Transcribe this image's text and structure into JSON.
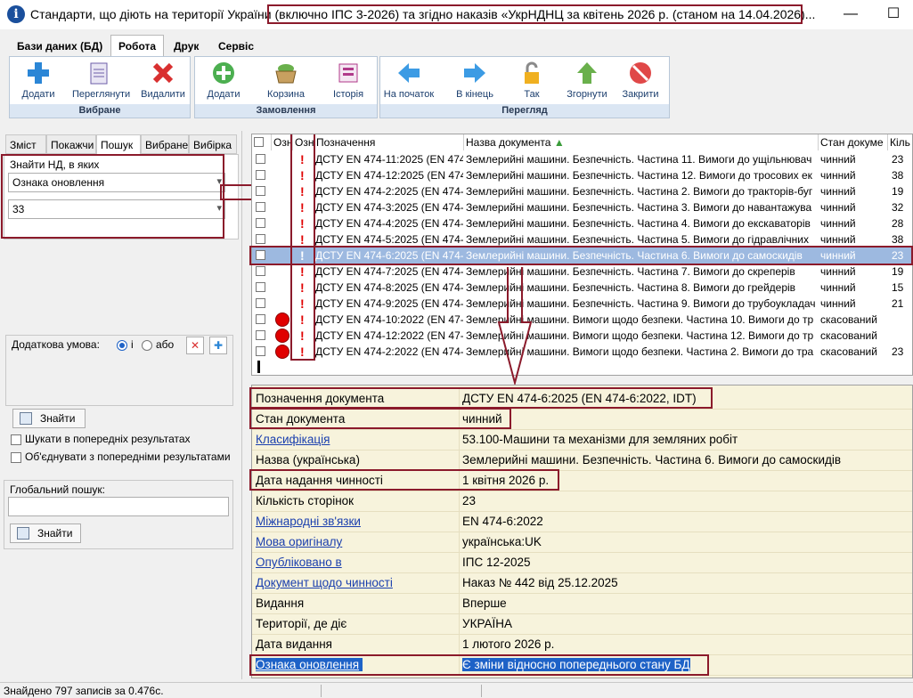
{
  "window": {
    "title": "Стандарти, що діють на території України (включно ІПС 3-2026) та згідно наказів «УкрНДНЦ за  квітень 2026 р. (станом на  14.04.2026)...",
    "minimize": "—",
    "maximize": "☐"
  },
  "menu": {
    "tabs": [
      "Бази даних (БД)",
      "Робота",
      "Друк",
      "Сервіс"
    ]
  },
  "ribbon": {
    "groups": [
      {
        "label": "Вибране",
        "buttons": [
          "Додати",
          "Переглянути",
          "Видалити"
        ]
      },
      {
        "label": "Замовлення",
        "buttons": [
          "Додати",
          "Корзина",
          "Історія"
        ]
      },
      {
        "label": "Перегляд",
        "buttons": [
          "На початок",
          "В кінець",
          "Так",
          "Згорнути",
          "Закрити"
        ]
      }
    ]
  },
  "left": {
    "tabs": [
      "Зміст",
      "Покажчи",
      "Пошук",
      "Вибране",
      "Вибірка"
    ],
    "find_label": "Знайти НД, в яких",
    "attribute_value": "Ознака оновлення",
    "code_value": "33",
    "extra_condition_label": "Додаткова умова:",
    "radio_and": "і",
    "radio_or": "або",
    "find_button": "Знайти",
    "search_prev": "Шукати в попередніх результатах",
    "merge_prev": "Об'єднувати з попередніми результатами",
    "global_label": "Глобальний пошук:",
    "global_value": "",
    "global_find_button": "Знайти"
  },
  "grid": {
    "headers": [
      "Озн",
      "Озн",
      "Позначення",
      "Назва документа",
      "Стан докуме",
      "Кіль"
    ],
    "rows": [
      {
        "code": "ДСТУ EN 474-11:2025 (EN 474-",
        "name": "Землерийні машини. Безпечність. Частина 11. Вимоги до ущільнювач",
        "status": "чинний",
        "pages": "23",
        "cancelled": false
      },
      {
        "code": "ДСТУ EN 474-12:2025 (EN 474-",
        "name": "Землерийні машини. Безпечність. Частина 12. Вимоги до тросових ек",
        "status": "чинний",
        "pages": "38",
        "cancelled": false
      },
      {
        "code": "ДСТУ EN 474-2:2025 (EN 474-",
        "name": "Землерийні машини. Безпечність. Частина 2. Вимоги до тракторів-буг",
        "status": "чинний",
        "pages": "19",
        "cancelled": false
      },
      {
        "code": "ДСТУ EN 474-3:2025 (EN 474-",
        "name": "Землерийні машини. Безпечність. Частина 3. Вимоги до навантажува",
        "status": "чинний",
        "pages": "32",
        "cancelled": false
      },
      {
        "code": "ДСТУ EN 474-4:2025 (EN 474-",
        "name": "Землерийні машини. Безпечність. Частина 4. Вимоги до екскаваторів",
        "status": "чинний",
        "pages": "28",
        "cancelled": false
      },
      {
        "code": "ДСТУ EN 474-5:2025 (EN 474-",
        "name": "Землерийні машини. Безпечність. Частина 5. Вимоги до гідравлічних",
        "status": "чинний",
        "pages": "38",
        "cancelled": false
      },
      {
        "code": "ДСТУ EN 474-6:2025 (EN 474-",
        "name": "Землерийні машини. Безпечність. Частина 6. Вимоги до самоскидів",
        "status": "чинний",
        "pages": "23",
        "cancelled": false,
        "selected": true
      },
      {
        "code": "ДСТУ EN 474-7:2025 (EN 474-",
        "name": "Землерийні машини. Безпечність. Частина 7. Вимоги до скреперів",
        "status": "чинний",
        "pages": "19",
        "cancelled": false
      },
      {
        "code": "ДСТУ EN 474-8:2025 (EN 474-",
        "name": "Землерийні машини. Безпечність. Частина 8. Вимоги до грейдерів",
        "status": "чинний",
        "pages": "15",
        "cancelled": false
      },
      {
        "code": "ДСТУ EN 474-9:2025 (EN 474-",
        "name": "Землерийні машини. Безпечність. Частина 9. Вимоги до трубоукладач",
        "status": "чинний",
        "pages": "21",
        "cancelled": false
      },
      {
        "code": "ДСТУ EN 474-10:2022 (EN 47-",
        "name": "Землерийні машини. Вимоги щодо безпеки. Частина 10. Вимоги до тр",
        "status": "скасований",
        "pages": "",
        "cancelled": true
      },
      {
        "code": "ДСТУ EN 474-12:2022 (EN 47-",
        "name": "Землерийні машини. Вимоги щодо безпеки. Частина 12. Вимоги до тр",
        "status": "скасований",
        "pages": "",
        "cancelled": true
      },
      {
        "code": "ДСТУ EN 474-2:2022 (EN 474-",
        "name": "Землерийні машини. Вимоги щодо безпеки. Частина 2. Вимоги до тра",
        "status": "скасований",
        "pages": "23",
        "cancelled": true
      }
    ]
  },
  "details": [
    {
      "key": "Позначення документа",
      "value": "ДСТУ EN 474-6:2025 (EN 474-6:2022, IDT)",
      "link": false
    },
    {
      "key": "Стан документа",
      "value": "чинний",
      "link": false
    },
    {
      "key": "Класифікація",
      "value": "53.100-Машини та механізми для земляних робіт",
      "link": true
    },
    {
      "key": "Назва (українська)",
      "value": "Землерийні машини. Безпечність. Частина 6. Вимоги до самоскидів",
      "link": false
    },
    {
      "key": "Дата надання чинності",
      "value": "1 квітня 2026 р.",
      "link": false
    },
    {
      "key": "Кількість сторінок",
      "value": "23",
      "link": false
    },
    {
      "key": "Міжнародні зв'язки",
      "value": "EN 474-6:2022",
      "link": true
    },
    {
      "key": "Мова оригіналу",
      "value": "українська:UK",
      "link": true
    },
    {
      "key": "Опубліковано в",
      "value": "ІПС 12-2025",
      "link": true
    },
    {
      "key": "Документ щодо чинності",
      "value": "Наказ № 442 від 25.12.2025",
      "link": true
    },
    {
      "key": "Видання",
      "value": "Вперше",
      "link": false
    },
    {
      "key": "Території, де діє",
      "value": "УКРАЇНА",
      "link": false
    },
    {
      "key": "Дата видання",
      "value": "1 лютого 2026 р.",
      "link": false
    },
    {
      "key": "Ознака оновлення",
      "value": "Є зміни відносно попереднього стану БД",
      "link": true,
      "highlight": true
    }
  ],
  "status": {
    "found": "Знайдено 797 записів за 0.476с."
  }
}
